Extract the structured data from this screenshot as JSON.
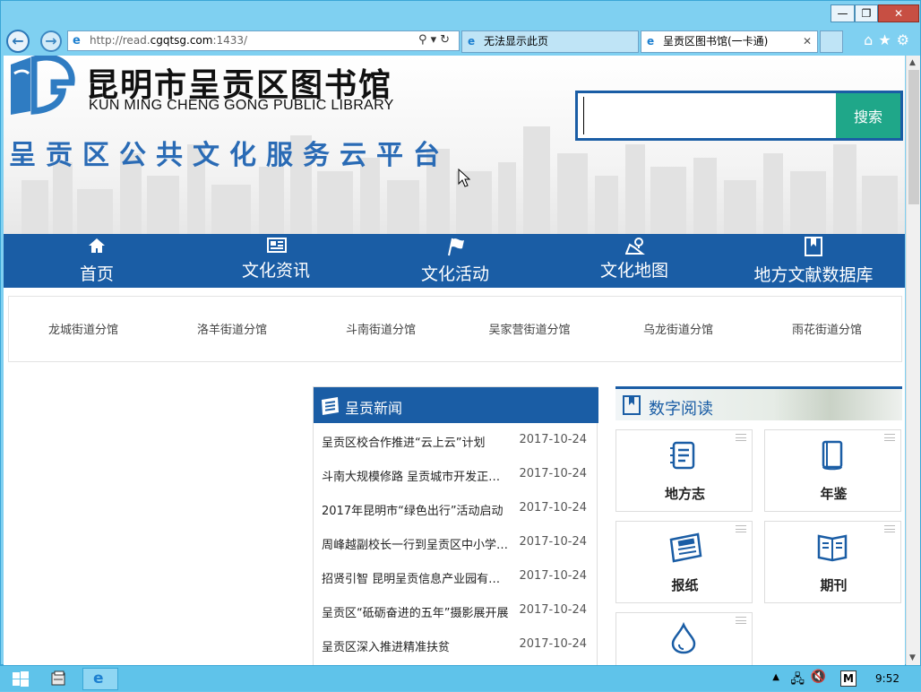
{
  "browser": {
    "address_url_prefix": "http://read.",
    "address_url_domain": "cgqtsg.com",
    "address_url_suffix": ":1433/",
    "tabs": [
      {
        "label": "无法显示此页",
        "active": false
      },
      {
        "label": "呈贡区图书馆(一卡通)",
        "active": true
      }
    ],
    "window_buttons": {
      "minimize": "—",
      "restore": "❐",
      "close": "✕"
    }
  },
  "header": {
    "library_name": "昆明市呈贡区图书馆",
    "library_name_en": "KUN MING CHENG GONG PUBLIC LIBRARY",
    "slogan": "呈贡区公共文化服务云平台",
    "search_placeholder": "",
    "search_button": "搜索"
  },
  "nav": {
    "items": [
      {
        "label": "首页",
        "icon": "home-icon"
      },
      {
        "label": "文化资讯",
        "icon": "news-icon"
      },
      {
        "label": "文化活动",
        "icon": "flag-icon"
      },
      {
        "label": "文化地图",
        "icon": "map-icon"
      },
      {
        "label": "地方文献数据库",
        "icon": "bookmark-icon"
      }
    ]
  },
  "branches": [
    "龙城街道分馆",
    "洛羊街道分馆",
    "斗南街道分馆",
    "吴家营街道分馆",
    "乌龙街道分馆",
    "雨花街道分馆"
  ],
  "news": {
    "title": "呈贡新闻",
    "items": [
      {
        "title": "呈贡区校合作推进“云上云”计划",
        "date": "2017-10-24"
      },
      {
        "title": "斗南大规模修路 呈贡城市开发正提速",
        "date": "2017-10-24"
      },
      {
        "title": "2017年昆明市“绿色出行”活动启动",
        "date": "2017-10-24"
      },
      {
        "title": "周峰越副校长一行到呈贡区中小学调研",
        "date": "2017-10-24"
      },
      {
        "title": "招贤引智 昆明呈贡信息产业园有限公司",
        "date": "2017-10-24"
      },
      {
        "title": "呈贡区“砥砺奋进的五年”摄影展开展",
        "date": "2017-10-24"
      },
      {
        "title": "呈贡区深入推进精准扶贫",
        "date": "2017-10-24"
      }
    ]
  },
  "digital_reading": {
    "title": "数字阅读",
    "cards": [
      {
        "label": "地方志",
        "icon": "gazetteer-icon"
      },
      {
        "label": "年鉴",
        "icon": "yearbook-icon"
      },
      {
        "label": "报纸",
        "icon": "newspaper-icon"
      },
      {
        "label": "期刊",
        "icon": "journal-icon"
      },
      {
        "label": "",
        "icon": "drop-icon"
      }
    ]
  },
  "taskbar": {
    "clock": "9:52",
    "ime": "M"
  },
  "colors": {
    "brand_blue": "#1a5da5",
    "search_green": "#1fa789",
    "os_blue": "#6ac8ee"
  }
}
